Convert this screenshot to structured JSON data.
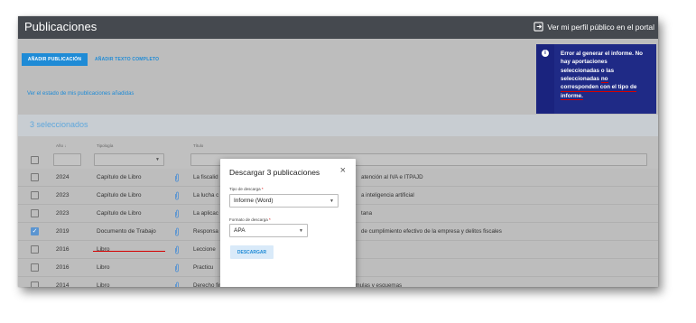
{
  "header": {
    "title": "Publicaciones",
    "profile_link": "Ver mi perfil público en el portal"
  },
  "toolbar": {
    "add_button": "AÑADIR PUBLICACIÓN",
    "add_fulltext_button": "AÑADIR TEXTO COMPLETO",
    "status_link": "Ver el estado de mis publicaciones añadidas"
  },
  "selection": {
    "count_label": "3 seleccionados"
  },
  "table": {
    "columns": [
      "Año",
      "Tipología",
      "Título"
    ],
    "sort_indicator": "↓",
    "rows": [
      {
        "year": "2024",
        "type": "Capítulo de Libro",
        "title_left": "La fiscalid",
        "title_right": "atención al IVA e ITPAJD",
        "checked": false
      },
      {
        "year": "2023",
        "type": "Capítulo de Libro",
        "title_left": "La lucha c",
        "title_right": "a inteligencia artificial",
        "checked": false
      },
      {
        "year": "2023",
        "type": "Capítulo de Libro",
        "title_left": "La aplicac",
        "title_right": "tana",
        "checked": false
      },
      {
        "year": "2019",
        "type": "Documento de Trabajo",
        "title_left": "Responsa",
        "title_right": "de cumplimiento efectivo de la empresa y delitos fiscales",
        "checked": true
      },
      {
        "year": "2016",
        "type": "Libro",
        "title_left": "Leccione",
        "title_right": "",
        "checked": false
      },
      {
        "year": "2016",
        "type": "Libro",
        "title_left": "Practicu",
        "title_right": "",
        "checked": false
      },
      {
        "year": "2014",
        "type": "Libro",
        "title_left": "Derecho financiero y tributario: parte especial, teoría, práctica, fórmulas y esquemas",
        "title_right": "",
        "checked": false
      }
    ]
  },
  "toast": {
    "line1": "Error al generar el informe. No",
    "line2": "hay aportaciones",
    "line3": "seleccionadas o las",
    "line4a": "seleccionadas ",
    "line4b": "no",
    "line5": "corresponden con el tipo de",
    "line6": "informe."
  },
  "dialog": {
    "title": "Descargar 3 publicaciones",
    "close_icon": "×",
    "download_type_label": "Tipo de descarga",
    "download_type_value": "Informe (Word)",
    "format_label": "Formato de descarga",
    "format_value": "APA",
    "required_mark": "*",
    "download_button": "DESCARGAR"
  },
  "colors": {
    "topbar": "#45494f",
    "accent": "#1f8bd6",
    "toast": "#1f2a86",
    "highlight": "#d40000"
  }
}
